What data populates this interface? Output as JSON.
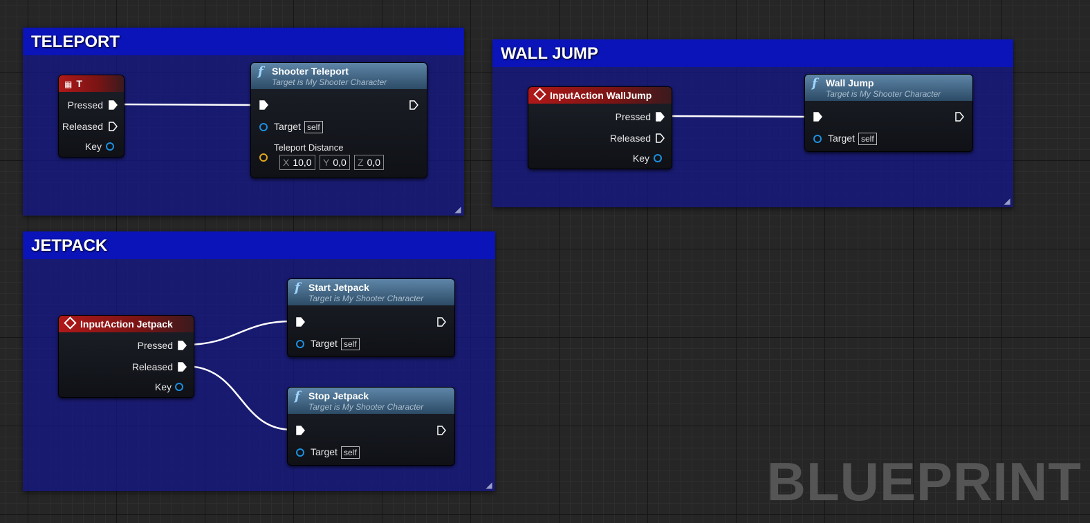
{
  "comments": {
    "teleport": "TELEPORT",
    "wall_jump": "WALL JUMP",
    "jetpack": "JETPACK"
  },
  "nodes": {
    "key_t": {
      "title": "T",
      "pressed": "Pressed",
      "released": "Released",
      "key": "Key"
    },
    "shooter_teleport": {
      "title": "Shooter Teleport",
      "subtitle": "Target is My Shooter Character",
      "target_label": "Target",
      "target_value": "self",
      "distance_label": "Teleport Distance",
      "x_axis": "X",
      "x_value": "10,0",
      "y_axis": "Y",
      "y_value": "0,0",
      "z_axis": "Z",
      "z_value": "0,0"
    },
    "input_walljump": {
      "title": "InputAction WallJump",
      "pressed": "Pressed",
      "released": "Released",
      "key": "Key"
    },
    "wall_jump": {
      "title": "Wall Jump",
      "subtitle": "Target is My Shooter Character",
      "target_label": "Target",
      "target_value": "self"
    },
    "input_jetpack": {
      "title": "InputAction Jetpack",
      "pressed": "Pressed",
      "released": "Released",
      "key": "Key"
    },
    "start_jetpack": {
      "title": "Start Jetpack",
      "subtitle": "Target is My Shooter Character",
      "target_label": "Target",
      "target_value": "self"
    },
    "stop_jetpack": {
      "title": "Stop Jetpack",
      "subtitle": "Target is My Shooter Character",
      "target_label": "Target",
      "target_value": "self"
    }
  },
  "function_icon": "function-f-icon",
  "event_icon": "diamond-event-icon",
  "key_icon": "keyboard-icon",
  "watermark": "BLUEPRINT",
  "colors": {
    "comment_header": "#0a14b8",
    "comment_body": "#14168c",
    "event_header": "#b01818",
    "function_header": "#4a7090",
    "object_pin": "#1d8fe0",
    "vector_pin": "#e0a820",
    "exec_wire": "#ffffff"
  }
}
